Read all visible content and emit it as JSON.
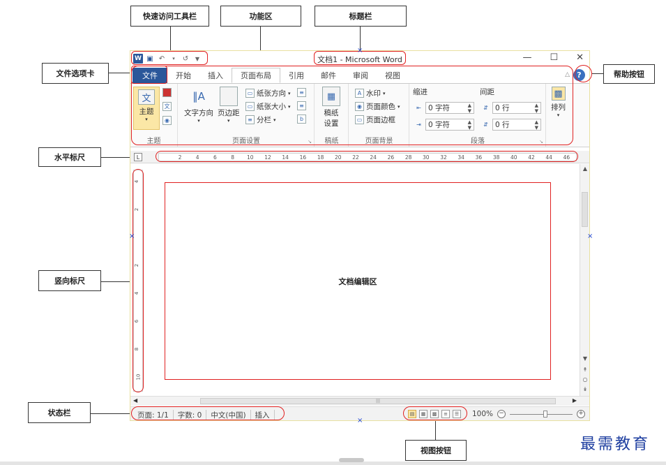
{
  "callouts": {
    "qat": "快速访问工具栏",
    "ribbon": "功能区",
    "titlebar": "标题栏",
    "file_tab": "文件选项卡",
    "help_button": "帮助按钮",
    "h_ruler": "水平标尺",
    "v_ruler": "竖向标尺",
    "doc_area": "文档编辑区",
    "status_bar": "状态栏",
    "view_buttons": "视图按钮"
  },
  "window": {
    "title": "文档1 - Microsoft Word",
    "tabs": [
      "文件",
      "开始",
      "插入",
      "页面布局",
      "引用",
      "邮件",
      "审阅",
      "视图"
    ],
    "help_glyph": "?"
  },
  "ribbon": {
    "theme_group": {
      "label": "主题",
      "button": "主题"
    },
    "page_setup": {
      "label": "页面设置",
      "text_dir": "文字方向",
      "margins": "页边距",
      "orientation": "纸张方向",
      "size": "纸张大小",
      "columns": "分栏"
    },
    "draft": {
      "label": "稿纸",
      "button_line1": "稿纸",
      "button_line2": "设置"
    },
    "background": {
      "label": "页面背景",
      "watermark": "水印",
      "page_color": "页面颜色",
      "page_border": "页面边框"
    },
    "paragraph": {
      "label": "段落",
      "indent": "缩进",
      "spacing": "间距",
      "indent_left": "0 字符",
      "indent_right": "0 字符",
      "spacing_before": "0 行",
      "spacing_after": "0 行"
    },
    "arrange": {
      "label": "排列"
    }
  },
  "ruler_ticks": [
    "2",
    "4",
    "6",
    "8",
    "10",
    "12",
    "14",
    "16",
    "18",
    "20",
    "22",
    "24",
    "26",
    "28",
    "30",
    "32",
    "34",
    "36",
    "38",
    "40",
    "42",
    "44",
    "46"
  ],
  "vruler_ticks": [
    "4",
    "2",
    "2",
    "4",
    "6",
    "8",
    "10"
  ],
  "status": {
    "page": "页面: 1/1",
    "words": "字数: 0",
    "lang": "中文(中国)",
    "mode": "插入",
    "zoom": "100%",
    "zoom_level_percent": 100
  },
  "watermark_text": "最需教育"
}
